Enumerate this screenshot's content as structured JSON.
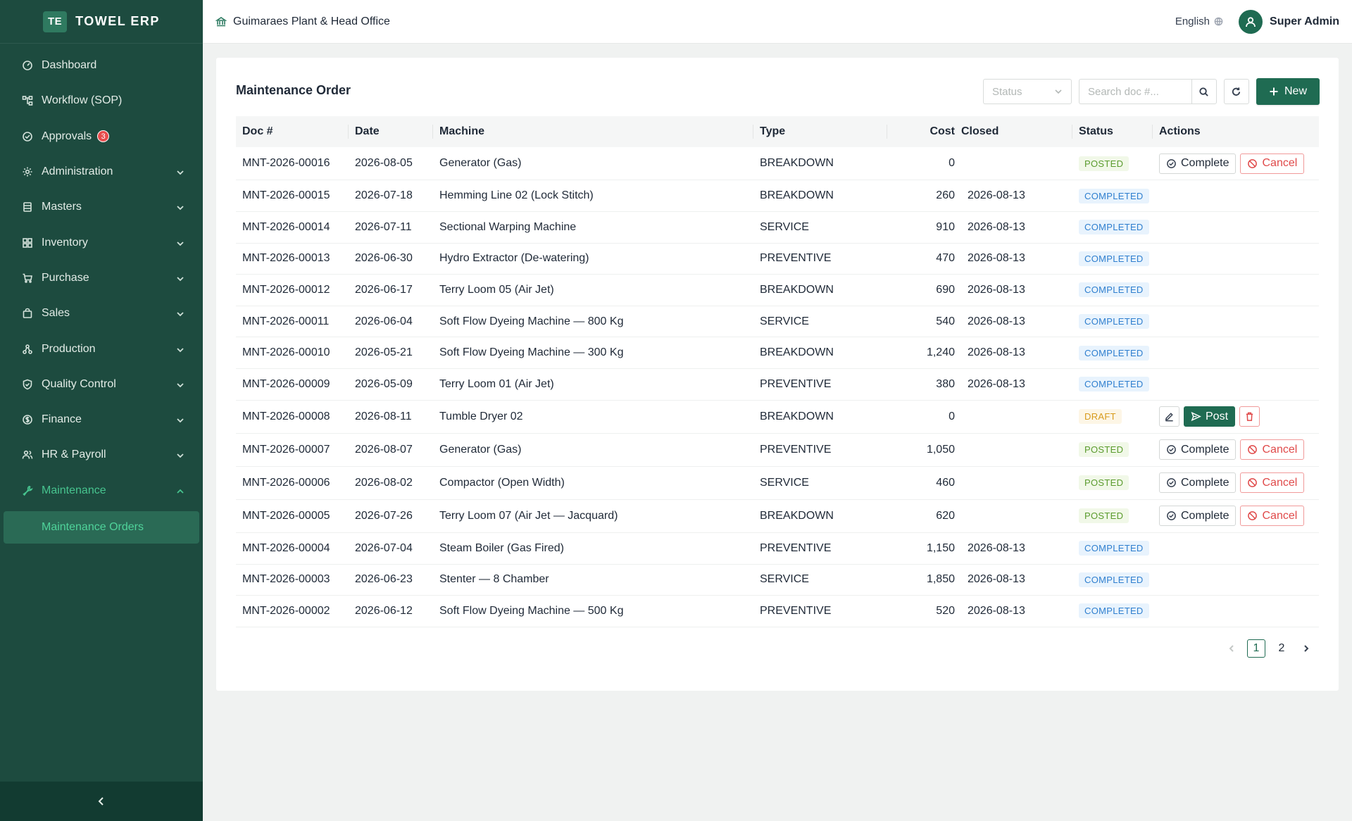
{
  "brand": {
    "logo": "TE",
    "name": "TOWEL ERP"
  },
  "sidebar": {
    "items": [
      {
        "label": "Dashboard",
        "icon": "dashboard-icon",
        "expandable": false
      },
      {
        "label": "Workflow (SOP)",
        "icon": "workflow-icon",
        "expandable": false
      },
      {
        "label": "Approvals",
        "icon": "check-circle-icon",
        "expandable": false,
        "badge": "3"
      },
      {
        "label": "Administration",
        "icon": "gear-icon",
        "expandable": true
      },
      {
        "label": "Masters",
        "icon": "database-icon",
        "expandable": true
      },
      {
        "label": "Inventory",
        "icon": "grid-icon",
        "expandable": true
      },
      {
        "label": "Purchase",
        "icon": "cart-icon",
        "expandable": true
      },
      {
        "label": "Sales",
        "icon": "bag-icon",
        "expandable": true
      },
      {
        "label": "Production",
        "icon": "production-icon",
        "expandable": true
      },
      {
        "label": "Quality Control",
        "icon": "shield-check-icon",
        "expandable": true
      },
      {
        "label": "Finance",
        "icon": "dollar-icon",
        "expandable": true
      },
      {
        "label": "HR & Payroll",
        "icon": "team-icon",
        "expandable": true
      },
      {
        "label": "Maintenance",
        "icon": "wrench-icon",
        "expandable": true,
        "active": true
      }
    ],
    "subitem": "Maintenance Orders"
  },
  "header": {
    "plant": "Guimaraes Plant & Head Office",
    "language": "English",
    "user": "Super Admin"
  },
  "page": {
    "title": "Maintenance Order",
    "status_placeholder": "Status",
    "search_placeholder": "Search doc #...",
    "new_label": "New"
  },
  "table": {
    "columns": [
      "Doc #",
      "Date",
      "Machine",
      "Type",
      "Cost",
      "Closed",
      "Status",
      "Actions"
    ],
    "rows": [
      {
        "doc": "MNT-2026-00016",
        "date": "2026-08-05",
        "machine": "Generator (Gas)",
        "type": "BREAKDOWN",
        "cost": "0",
        "closed": "",
        "status": "POSTED",
        "actions": "complete-cancel"
      },
      {
        "doc": "MNT-2026-00015",
        "date": "2026-07-18",
        "machine": "Hemming Line 02 (Lock Stitch)",
        "type": "BREAKDOWN",
        "cost": "260",
        "closed": "2026-08-13",
        "status": "COMPLETED",
        "actions": "none"
      },
      {
        "doc": "MNT-2026-00014",
        "date": "2026-07-11",
        "machine": "Sectional Warping Machine",
        "type": "SERVICE",
        "cost": "910",
        "closed": "2026-08-13",
        "status": "COMPLETED",
        "actions": "none"
      },
      {
        "doc": "MNT-2026-00013",
        "date": "2026-06-30",
        "machine": "Hydro Extractor (De-watering)",
        "type": "PREVENTIVE",
        "cost": "470",
        "closed": "2026-08-13",
        "status": "COMPLETED",
        "actions": "none"
      },
      {
        "doc": "MNT-2026-00012",
        "date": "2026-06-17",
        "machine": "Terry Loom 05 (Air Jet)",
        "type": "BREAKDOWN",
        "cost": "690",
        "closed": "2026-08-13",
        "status": "COMPLETED",
        "actions": "none"
      },
      {
        "doc": "MNT-2026-00011",
        "date": "2026-06-04",
        "machine": "Soft Flow Dyeing Machine — 800 Kg",
        "type": "SERVICE",
        "cost": "540",
        "closed": "2026-08-13",
        "status": "COMPLETED",
        "actions": "none"
      },
      {
        "doc": "MNT-2026-00010",
        "date": "2026-05-21",
        "machine": "Soft Flow Dyeing Machine — 300 Kg",
        "type": "BREAKDOWN",
        "cost": "1,240",
        "closed": "2026-08-13",
        "status": "COMPLETED",
        "actions": "none"
      },
      {
        "doc": "MNT-2026-00009",
        "date": "2026-05-09",
        "machine": "Terry Loom 01 (Air Jet)",
        "type": "PREVENTIVE",
        "cost": "380",
        "closed": "2026-08-13",
        "status": "COMPLETED",
        "actions": "none"
      },
      {
        "doc": "MNT-2026-00008",
        "date": "2026-08-11",
        "machine": "Tumble Dryer 02",
        "type": "BREAKDOWN",
        "cost": "0",
        "closed": "",
        "status": "DRAFT",
        "actions": "edit-post-delete"
      },
      {
        "doc": "MNT-2026-00007",
        "date": "2026-08-07",
        "machine": "Generator (Gas)",
        "type": "PREVENTIVE",
        "cost": "1,050",
        "closed": "",
        "status": "POSTED",
        "actions": "complete-cancel"
      },
      {
        "doc": "MNT-2026-00006",
        "date": "2026-08-02",
        "machine": "Compactor (Open Width)",
        "type": "SERVICE",
        "cost": "460",
        "closed": "",
        "status": "POSTED",
        "actions": "complete-cancel"
      },
      {
        "doc": "MNT-2026-00005",
        "date": "2026-07-26",
        "machine": "Terry Loom 07 (Air Jet — Jacquard)",
        "type": "BREAKDOWN",
        "cost": "620",
        "closed": "",
        "status": "POSTED",
        "actions": "complete-cancel"
      },
      {
        "doc": "MNT-2026-00004",
        "date": "2026-07-04",
        "machine": "Steam Boiler (Gas Fired)",
        "type": "PREVENTIVE",
        "cost": "1,150",
        "closed": "2026-08-13",
        "status": "COMPLETED",
        "actions": "none"
      },
      {
        "doc": "MNT-2026-00003",
        "date": "2026-06-23",
        "machine": "Stenter — 8 Chamber",
        "type": "SERVICE",
        "cost": "1,850",
        "closed": "2026-08-13",
        "status": "COMPLETED",
        "actions": "none"
      },
      {
        "doc": "MNT-2026-00002",
        "date": "2026-06-12",
        "machine": "Soft Flow Dyeing Machine — 500 Kg",
        "type": "PREVENTIVE",
        "cost": "520",
        "closed": "2026-08-13",
        "status": "COMPLETED",
        "actions": "none"
      }
    ],
    "action_labels": {
      "complete": "Complete",
      "cancel": "Cancel",
      "post": "Post"
    }
  },
  "pagination": {
    "pages": [
      "1",
      "2"
    ],
    "current": "1"
  },
  "colors": {
    "sidebar": "#1d4b3f",
    "accent": "#1f6b52",
    "active_text": "#47c48f",
    "danger": "#e04a4a"
  }
}
